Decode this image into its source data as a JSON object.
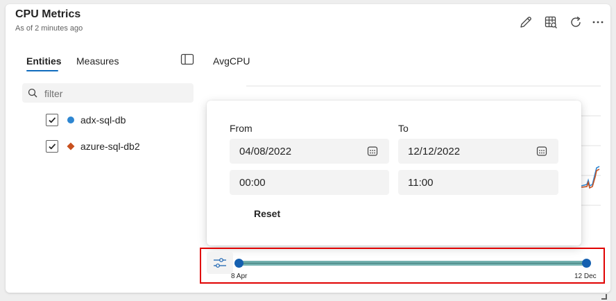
{
  "header": {
    "title": "CPU Metrics",
    "subtitle": "As of 2 minutes ago",
    "icons": [
      "pencil-icon",
      "table-search-icon",
      "refresh-icon",
      "more-icon"
    ]
  },
  "tabs": [
    {
      "label": "Entities",
      "active": true
    },
    {
      "label": "Measures",
      "active": false
    }
  ],
  "search": {
    "placeholder": "filter",
    "value": ""
  },
  "entities": [
    {
      "label": "adx-sql-db",
      "checked": true,
      "marker": "circle",
      "color": "#2e86d1"
    },
    {
      "label": "azure-sql-db2",
      "checked": true,
      "marker": "diamond",
      "color": "#c8501e"
    }
  ],
  "chart": {
    "title": "AvgCPU",
    "series_colors": [
      "#2e86d1",
      "#c8501e"
    ]
  },
  "time_popup": {
    "from_label": "From",
    "to_label": "To",
    "from_date": "04/08/2022",
    "to_date": "12/12/2022",
    "from_time": "00:00",
    "to_time": "11:00",
    "reset_label": "Reset"
  },
  "range_slider": {
    "start_label": "8 Apr",
    "end_label": "12 Dec",
    "highlight_color": "#e00000",
    "track_color": "#72b0ae",
    "handle_color": "#1560b0"
  }
}
